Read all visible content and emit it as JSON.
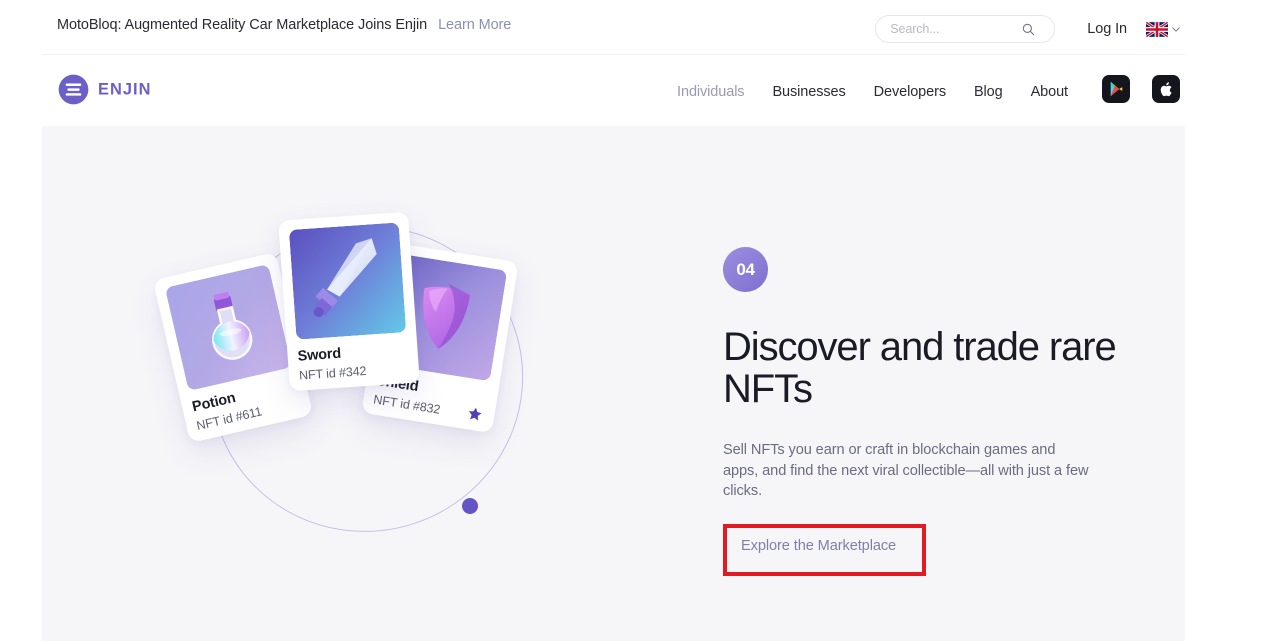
{
  "announcement": {
    "text": "MotoBloq: Augmented Reality Car Marketplace Joins Enjin",
    "link_label": "Learn More"
  },
  "topbar": {
    "search_placeholder": "Search...",
    "search_value": "",
    "search_icon": "search-icon",
    "login_label": "Log In",
    "language_flag": "uk-flag-icon",
    "language_chevron": "chevron-down-icon"
  },
  "brand": {
    "logo_text": "ENJIN",
    "logo_mark": "enjin-circle-logo-icon",
    "accent": "#6c5fc7"
  },
  "nav": {
    "items": [
      {
        "label": "Individuals",
        "muted": true
      },
      {
        "label": "Businesses",
        "muted": false
      },
      {
        "label": "Developers",
        "muted": false
      },
      {
        "label": "Blog",
        "muted": false
      },
      {
        "label": "About",
        "muted": false
      }
    ],
    "stores": [
      {
        "name": "google-play-icon"
      },
      {
        "name": "apple-app-store-icon"
      }
    ]
  },
  "hero": {
    "step_number": "04",
    "title": "Discover and trade rare NFTs",
    "body": "Sell NFTs you earn or craft in blockchain games and apps, and find the next viral collectible—all with just a few clicks.",
    "cta_label": "Explore the Marketplace",
    "highlight_color": "#e01b22",
    "background": "#f6f6f9"
  },
  "illustration": {
    "cards": [
      {
        "name": "Potion",
        "id": "NFT id #611",
        "icon": "potion-flask-icon"
      },
      {
        "name": "Sword",
        "id": "NFT id #342",
        "icon": "sword-icon"
      },
      {
        "name": "Shield",
        "id": "NFT id #832",
        "icon": "shield-icon"
      }
    ],
    "orbit_dots": 2,
    "star_badge": "star-icon"
  }
}
